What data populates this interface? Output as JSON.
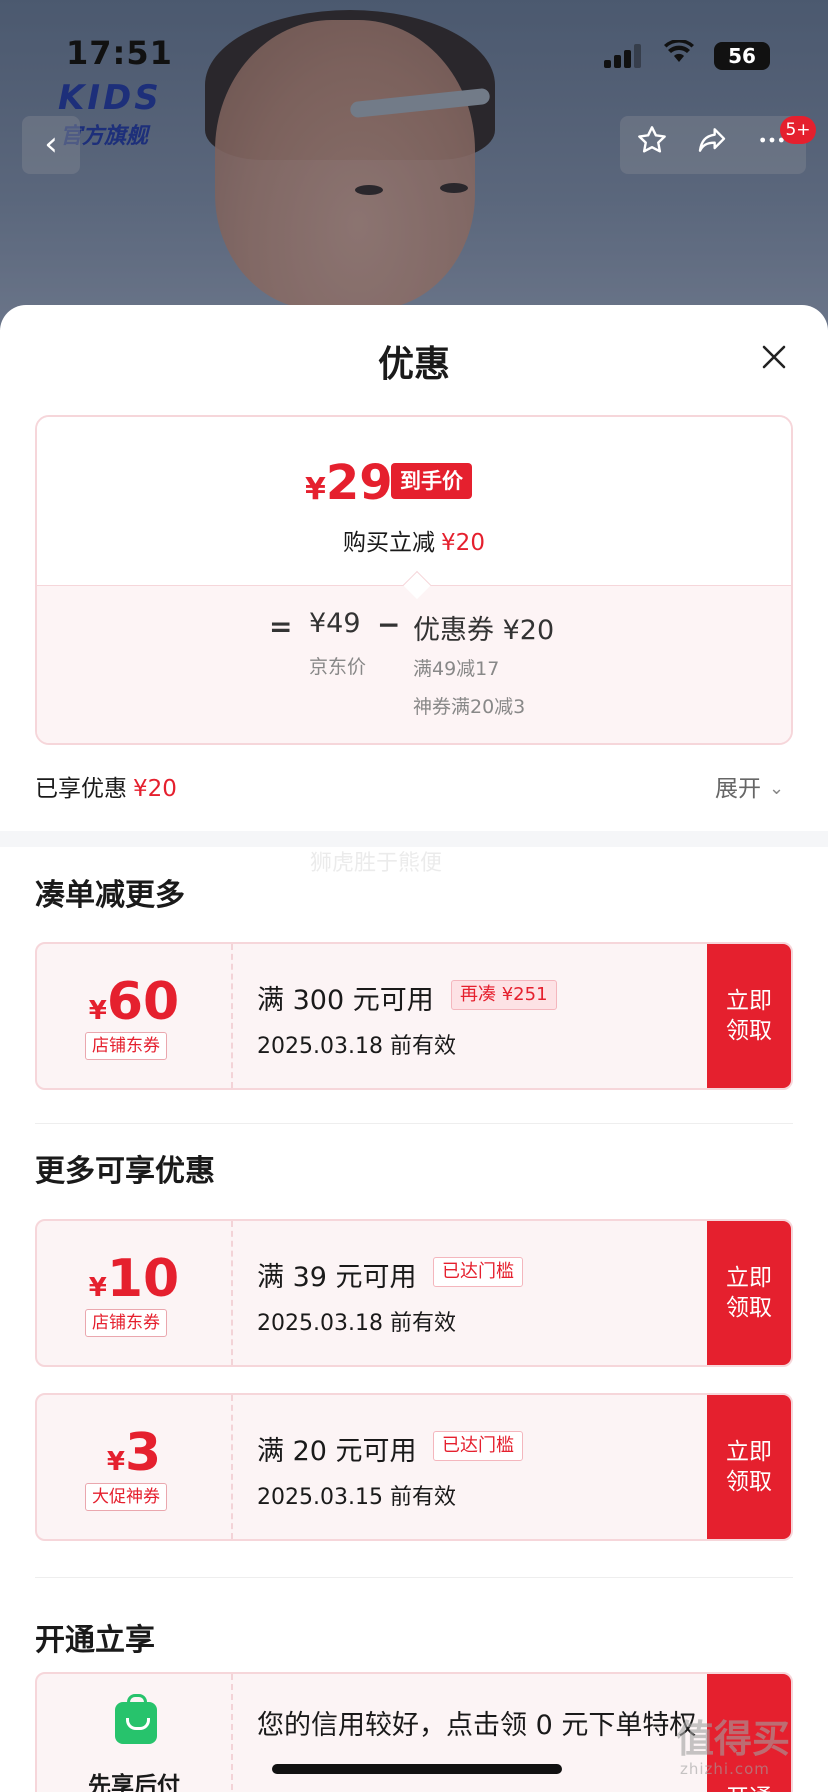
{
  "status_bar": {
    "time": "17:51",
    "battery": "56"
  },
  "brand": {
    "logo": "KIDS",
    "subtitle": "官方旗舰"
  },
  "nav": {
    "back_icon": "chevron-left-icon",
    "star_icon": "star-icon",
    "share_icon": "share-icon",
    "more_icon": "more-icon",
    "badge": "5+"
  },
  "sheet": {
    "title": "优惠",
    "price_card": {
      "final_symbol": "¥",
      "final_price": "29",
      "final_tag": "到手价",
      "instant_label": "购买立减",
      "instant_amount": "¥20",
      "equals": "=",
      "jd_price": "¥49",
      "jd_label": "京东价",
      "minus": "−",
      "coupon_label": "优惠券 ¥20",
      "coupon_detail_1": "满49减17",
      "coupon_detail_2": "神券满20减3"
    },
    "enjoyed": {
      "label": "已享优惠",
      "amount": "¥20",
      "expand": "展开"
    },
    "watermark": "狮虎胜于熊便"
  },
  "section_combo": {
    "title": "凑单减更多",
    "coupons": [
      {
        "symbol": "¥",
        "value": "60",
        "type": "店铺东券",
        "condition": "满 300 元可用",
        "tag": "再凑 ¥251",
        "valid": "2025.03.18 前有效",
        "claim": "立即领取"
      }
    ]
  },
  "section_more": {
    "title": "更多可享优惠",
    "coupons": [
      {
        "symbol": "¥",
        "value": "10",
        "type": "店铺东券",
        "condition": "满 39 元可用",
        "tag": "已达门槛",
        "valid": "2025.03.18 前有效",
        "claim": "立即领取"
      },
      {
        "symbol": "¥",
        "value": "3",
        "type": "大促神券",
        "condition": "满 20 元可用",
        "tag": "已达门槛",
        "valid": "2025.03.15 前有效",
        "claim": "立即领取"
      }
    ]
  },
  "section_open": {
    "title": "开通立享",
    "bnpl": {
      "title": "先享后付",
      "desc": "您的信用较好，点击领 0 元下单特权",
      "claim": "开通"
    }
  },
  "corner_watermark": {
    "main": "值得买",
    "sub": "zhizhi.com"
  },
  "colors": {
    "accent": "#e5202e",
    "coupon_bg": "#fcf4f5",
    "coupon_border": "#f6d6da"
  }
}
